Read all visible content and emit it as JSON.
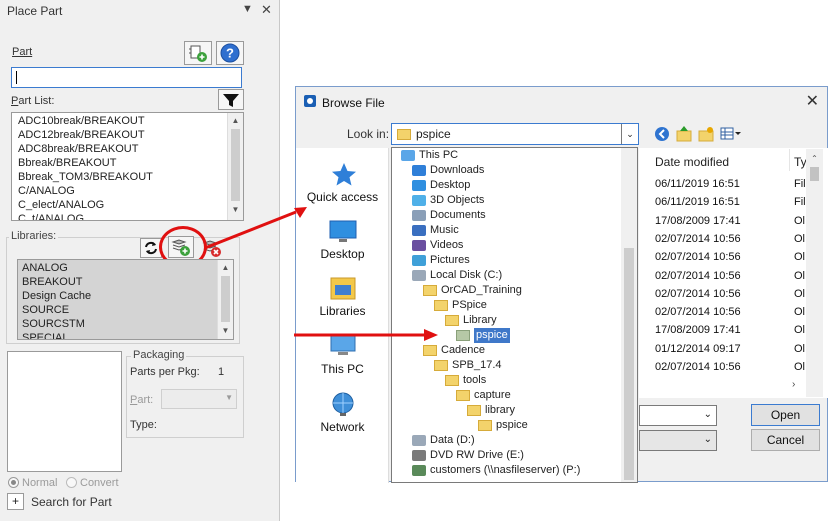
{
  "place_part": {
    "title": "Place Part",
    "part_label": "Part",
    "part_value": "",
    "part_list_label": "Part List:",
    "parts": [
      "ADC10break/BREAKOUT",
      "ADC12break/BREAKOUT",
      "ADC8break/BREAKOUT",
      "Bbreak/BREAKOUT",
      "Bbreak_TOM3/BREAKOUT",
      "C/ANALOG",
      "C_elect/ANALOG",
      "C_t/ANALOG"
    ],
    "libraries_label": "Libraries:",
    "libraries": [
      "ANALOG",
      "BREAKOUT",
      "Design Cache",
      "SOURCE",
      "SOURCSTM",
      "SPECIAL"
    ],
    "packaging_label": "Packaging",
    "parts_per_pkg_label": "Parts per Pkg:",
    "parts_per_pkg_value": "1",
    "part_label2": "Part:",
    "type_label": "Type:",
    "normal_label": "Normal",
    "convert_label": "Convert",
    "search_expand": "+",
    "search_label": "Search for Part"
  },
  "browse": {
    "title": "Browse File",
    "look_in_label": "Look in:",
    "look_in_value": "pspice",
    "sidebar": [
      "Quick access",
      "Desktop",
      "Libraries",
      "This PC",
      "Network"
    ],
    "tree": [
      {
        "label": "This PC",
        "indent": 0,
        "icon": "pc"
      },
      {
        "label": "Downloads",
        "indent": 1,
        "icon": "download"
      },
      {
        "label": "Desktop",
        "indent": 1,
        "icon": "desktop"
      },
      {
        "label": "3D Objects",
        "indent": 1,
        "icon": "3d"
      },
      {
        "label": "Documents",
        "indent": 1,
        "icon": "documents"
      },
      {
        "label": "Music",
        "indent": 1,
        "icon": "music"
      },
      {
        "label": "Videos",
        "indent": 1,
        "icon": "videos"
      },
      {
        "label": "Pictures",
        "indent": 1,
        "icon": "pictures"
      },
      {
        "label": "Local Disk (C:)",
        "indent": 1,
        "icon": "disk"
      },
      {
        "label": "OrCAD_Training",
        "indent": 2,
        "icon": "folder"
      },
      {
        "label": "PSpice",
        "indent": 3,
        "icon": "folder"
      },
      {
        "label": "Library",
        "indent": 4,
        "icon": "folder"
      },
      {
        "label": "pspice",
        "indent": 5,
        "icon": "folder-green",
        "selected": true
      },
      {
        "label": "Cadence",
        "indent": 2,
        "icon": "folder"
      },
      {
        "label": "SPB_17.4",
        "indent": 3,
        "icon": "folder"
      },
      {
        "label": "tools",
        "indent": 4,
        "icon": "folder"
      },
      {
        "label": "capture",
        "indent": 5,
        "icon": "folder"
      },
      {
        "label": "library",
        "indent": 6,
        "icon": "folder"
      },
      {
        "label": "pspice",
        "indent": 7,
        "icon": "folder"
      },
      {
        "label": "Data (D:)",
        "indent": 1,
        "icon": "disk"
      },
      {
        "label": "DVD RW Drive (E:)",
        "indent": 1,
        "icon": "dvd"
      },
      {
        "label": "customers (\\\\nasfileserver) (P:)",
        "indent": 1,
        "icon": "netdrive"
      }
    ],
    "columns": {
      "date_modified": "Date modified",
      "type": "Ty"
    },
    "rows": [
      {
        "date": "06/11/2019 16:51",
        "type": "Fil"
      },
      {
        "date": "06/11/2019 16:51",
        "type": "Fil"
      },
      {
        "date": "17/08/2009 17:41",
        "type": "Ol"
      },
      {
        "date": "02/07/2014 10:56",
        "type": "Ol"
      },
      {
        "date": "02/07/2014 10:56",
        "type": "Ol"
      },
      {
        "date": "02/07/2014 10:56",
        "type": "Ol"
      },
      {
        "date": "02/07/2014 10:56",
        "type": "Ol"
      },
      {
        "date": "02/07/2014 10:56",
        "type": "Ol"
      },
      {
        "date": "17/08/2009 17:41",
        "type": "Ol"
      },
      {
        "date": "01/12/2014 09:17",
        "type": "Ol"
      },
      {
        "date": "02/07/2014 10:56",
        "type": "Ol"
      }
    ],
    "open_label": "Open",
    "cancel_label": "Cancel"
  }
}
